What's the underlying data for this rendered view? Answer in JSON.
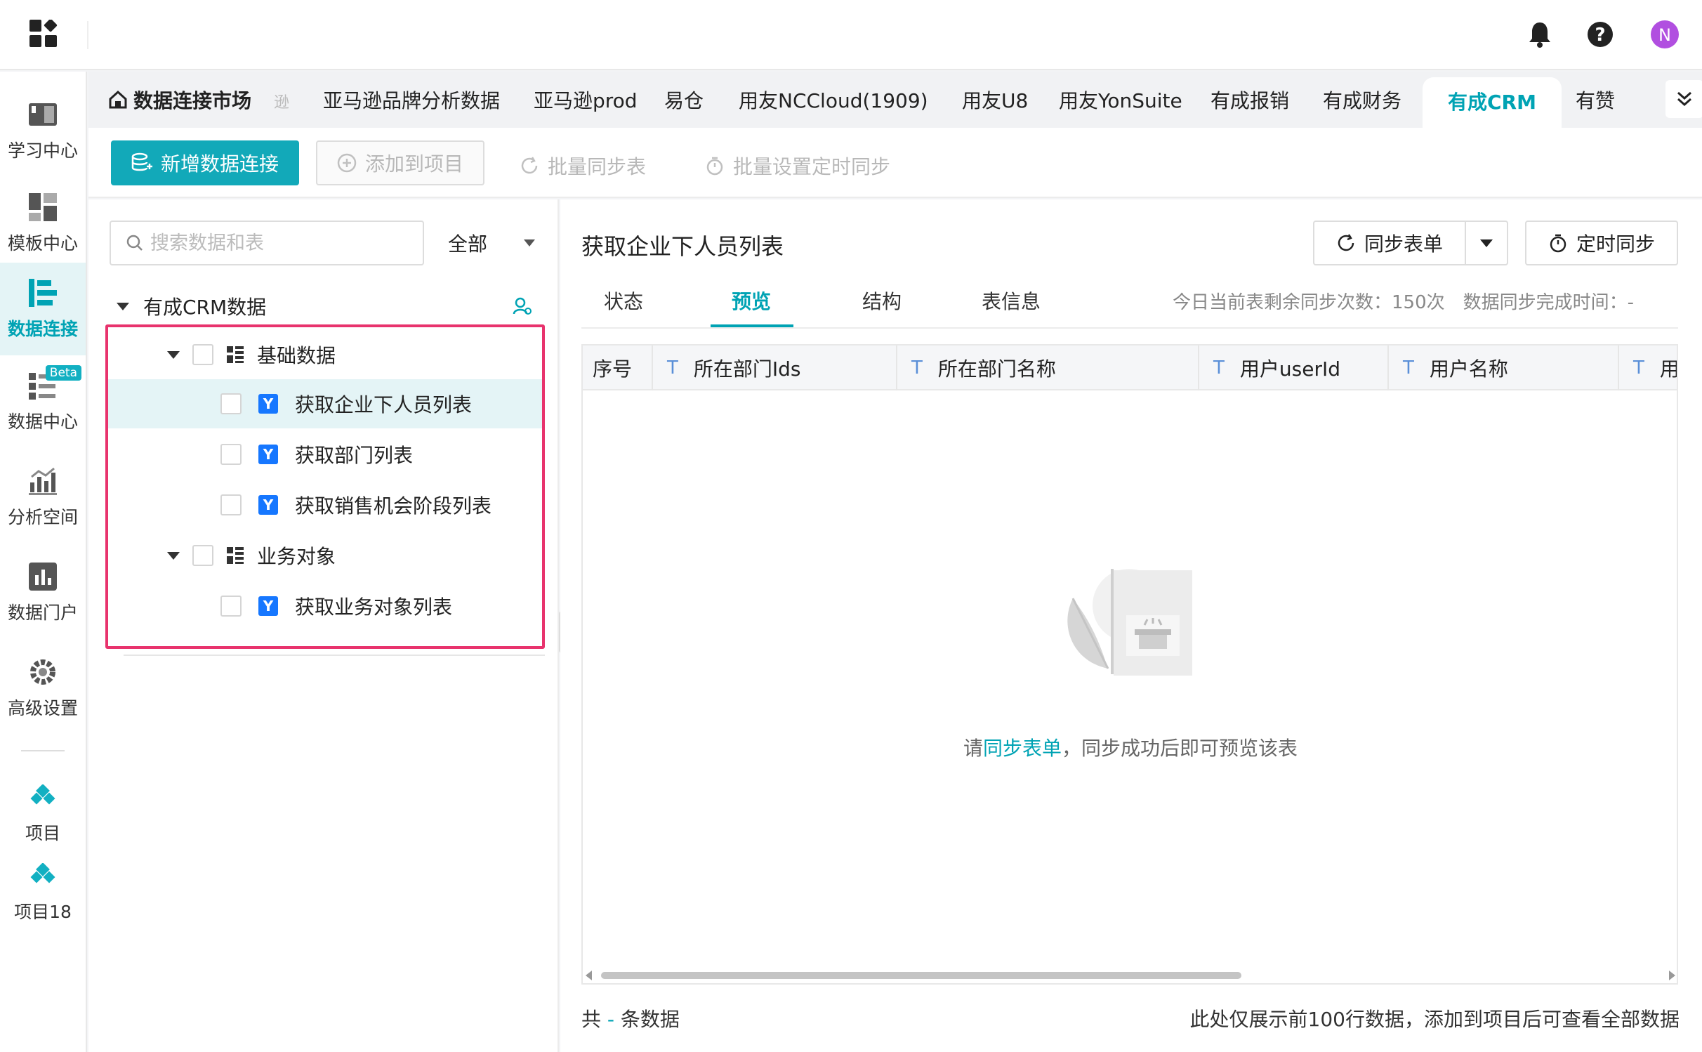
{
  "sidebar": {
    "items": [
      {
        "label": "学习中心",
        "icon": "book-icon"
      },
      {
        "label": "模板中心",
        "icon": "template-icon"
      },
      {
        "label": "数据连接",
        "icon": "data-connect-icon",
        "active": true
      },
      {
        "label": "数据中心",
        "icon": "data-center-icon",
        "badge": "Beta"
      },
      {
        "label": "分析空间",
        "icon": "analysis-icon"
      },
      {
        "label": "数据门户",
        "icon": "portal-icon"
      },
      {
        "label": "高级设置",
        "icon": "gear-icon"
      },
      {
        "label": "项目",
        "icon": "project-icon"
      },
      {
        "label": "项目18",
        "icon": "project-icon"
      }
    ]
  },
  "topbar": {
    "avatar_letter": "N",
    "icons": [
      "bell-icon",
      "help-icon",
      "avatar"
    ]
  },
  "tabs": {
    "home": "数据连接市场",
    "partial": "逊",
    "items": [
      "亚马逊品牌分析数据",
      "亚马逊prod",
      "易仓",
      "用友NCCloud(1909)",
      "用友U8",
      "用友YonSuite",
      "有成报销",
      "有成财务",
      "有成CRM",
      "有赞"
    ],
    "active": "有成CRM"
  },
  "toolbar": {
    "new_connection": "新增数据连接",
    "add_to_project": "添加到项目",
    "batch_sync": "批量同步表",
    "batch_schedule": "批量设置定时同步"
  },
  "left": {
    "search_placeholder": "搜索数据和表",
    "filter": "全部",
    "root": "有成CRM数据",
    "groups": [
      {
        "label": "基础数据",
        "items": [
          "获取企业下人员列表",
          "获取部门列表",
          "获取销售机会阶段列表"
        ]
      },
      {
        "label": "业务对象",
        "items": [
          "获取业务对象列表"
        ]
      }
    ],
    "type_badge": "Y"
  },
  "right": {
    "title": "获取企业下人员列表",
    "sync_btn": "同步表单",
    "timer_btn": "定时同步",
    "tabs": [
      "状态",
      "预览",
      "结构",
      "表信息"
    ],
    "active_tab": "预览",
    "sync_info": "今日当前表剩余同步次数：150次　数据同步完成时间：-",
    "columns": [
      {
        "label": "序号",
        "type": ""
      },
      {
        "label": "所在部门Ids",
        "type": "T"
      },
      {
        "label": "所在部门名称",
        "type": "T"
      },
      {
        "label": "用户userId",
        "type": "T"
      },
      {
        "label": "用户名称",
        "type": "T"
      },
      {
        "label": "用户",
        "type": "T"
      }
    ],
    "empty": {
      "prefix": "请",
      "link": "同步表单",
      "suffix": "，同步成功后即可预览该表"
    },
    "footer": {
      "prefix": "共 ",
      "count": "-",
      "suffix": " 条数据",
      "note": "此处仅展示前100行数据，添加到项目后可查看全部数据"
    }
  },
  "colors": {
    "accent": "#12a9b9",
    "highlight": "#e8336d",
    "type_badge": "#1677ff"
  }
}
